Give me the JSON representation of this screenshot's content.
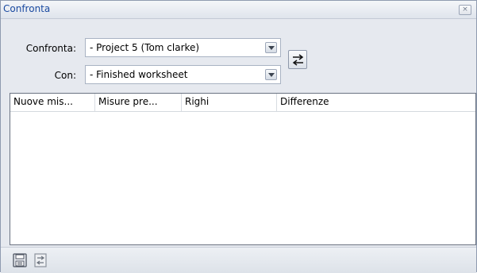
{
  "window": {
    "title": "Confronta",
    "close_glyph": "×"
  },
  "compare": {
    "confronta_label": "Confronta:",
    "confronta_value": "- Project 5 (Tom clarke)",
    "con_label": "Con:",
    "con_value": "- Finished worksheet"
  },
  "grid": {
    "columns": [
      "Nuove mis...",
      "Misure pre...",
      "Righi",
      "Differenze"
    ]
  },
  "icons": {
    "close": "close-icon",
    "dropdown": "chevron-down-icon",
    "swap": "swap-icon",
    "save": "save-icon",
    "compare": "compare-icon"
  }
}
